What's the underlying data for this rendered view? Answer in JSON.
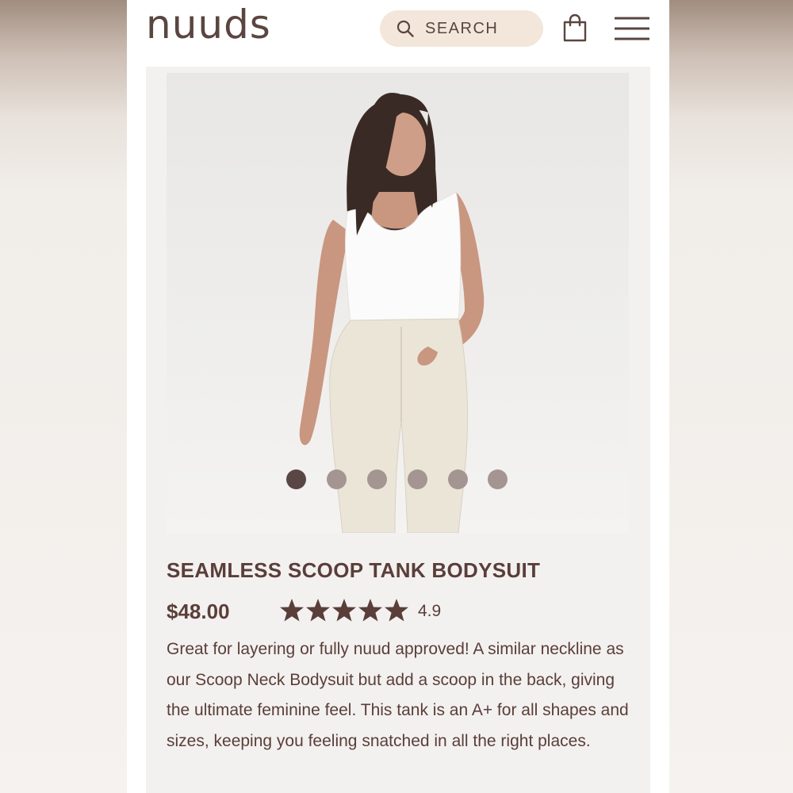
{
  "header": {
    "logo": "nuuds",
    "search_label": "SEARCH"
  },
  "gallery": {
    "image_count": 6,
    "active_index": 0
  },
  "product": {
    "title": "SEAMLESS SCOOP TANK BODYSUIT",
    "price": "$48.00",
    "stars": 5,
    "rating": "4.9",
    "description": "Great for layering or fully nuud approved! A similar neckline as our Scoop Neck Bodysuit but add a scoop in the back, giving the ultimate feminine feel. This tank is an A+ for all shapes and sizes, keeping you feeling snatched in all the right places."
  },
  "colors": {
    "brand_text": "#5a3e3a",
    "search_bg": "#f2e7da",
    "dot_active": "#5a4644",
    "dot_inactive": "#a49592"
  },
  "icons": {
    "search": "search-icon",
    "bag": "shopping-bag-icon",
    "menu": "hamburger-menu-icon",
    "star": "star-icon"
  }
}
